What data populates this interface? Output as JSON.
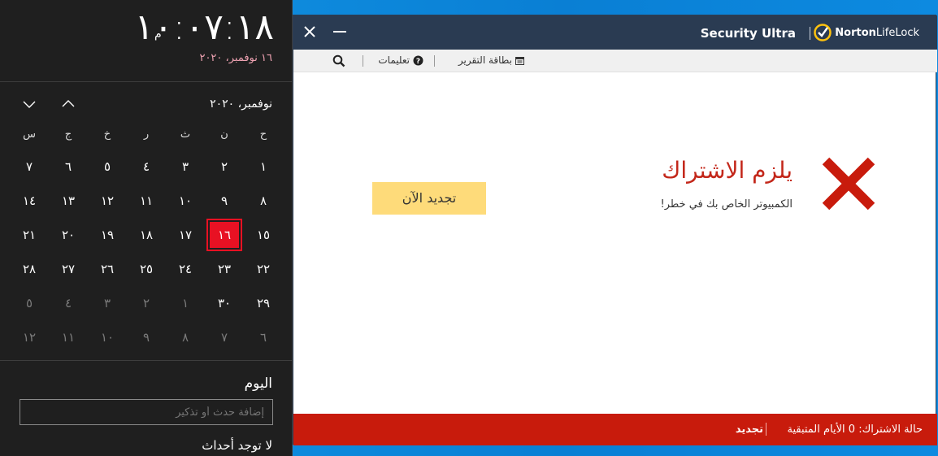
{
  "flyout": {
    "clock": "١٠:٠٧:١٨",
    "ampm": "م",
    "date_line": "١٦ نوفمبر، ٢٠٢٠",
    "month_title": "نوفمبر، ٢٠٢٠",
    "weekdays": [
      "ح",
      "ن",
      "ث",
      "ر",
      "خ",
      "ج",
      "س"
    ],
    "weeks": [
      [
        {
          "d": "١"
        },
        {
          "d": "٢"
        },
        {
          "d": "٣"
        },
        {
          "d": "٤"
        },
        {
          "d": "٥"
        },
        {
          "d": "٦"
        },
        {
          "d": "٧"
        }
      ],
      [
        {
          "d": "٨"
        },
        {
          "d": "٩"
        },
        {
          "d": "١٠"
        },
        {
          "d": "١١"
        },
        {
          "d": "١٢"
        },
        {
          "d": "١٣"
        },
        {
          "d": "١٤"
        }
      ],
      [
        {
          "d": "١٥"
        },
        {
          "d": "١٦",
          "today": true
        },
        {
          "d": "١٧"
        },
        {
          "d": "١٨"
        },
        {
          "d": "١٩"
        },
        {
          "d": "٢٠"
        },
        {
          "d": "٢١"
        }
      ],
      [
        {
          "d": "٢٢"
        },
        {
          "d": "٢٣"
        },
        {
          "d": "٢٤"
        },
        {
          "d": "٢٥"
        },
        {
          "d": "٢٦"
        },
        {
          "d": "٢٧"
        },
        {
          "d": "٢٨"
        }
      ],
      [
        {
          "d": "٢٩"
        },
        {
          "d": "٣٠"
        },
        {
          "d": "١",
          "dim": true
        },
        {
          "d": "٢",
          "dim": true
        },
        {
          "d": "٣",
          "dim": true
        },
        {
          "d": "٤",
          "dim": true
        },
        {
          "d": "٥",
          "dim": true
        }
      ],
      [
        {
          "d": "٦",
          "dim": true
        },
        {
          "d": "٧",
          "dim": true
        },
        {
          "d": "٨",
          "dim": true
        },
        {
          "d": "٩",
          "dim": true
        },
        {
          "d": "١٠",
          "dim": true
        },
        {
          "d": "١١",
          "dim": true
        },
        {
          "d": "١٢",
          "dim": true
        }
      ]
    ],
    "today_label": "اليوم",
    "event_placeholder": "إضافة حدث أو تذكير",
    "no_events": "لا توجد أحداث",
    "icons": {
      "prev": "chevron-up-icon",
      "next": "chevron-down-icon"
    },
    "colors": {
      "today_accent": "#e81123",
      "date_line": "#f0a3b3"
    }
  },
  "norton": {
    "product_name": "Security Ultra",
    "brand_name_bold": "Norton",
    "brand_name_light": "LifeLock",
    "menu": {
      "report_card": "بطاقة التقرير",
      "help": "تعليمات"
    },
    "alert": {
      "title": "يلزم الاشتراك",
      "subtitle": "الكمبيوتر الخاص بك في خطر!",
      "renew_button": "تجديد الآن"
    },
    "status": {
      "text": "حالة الاشتراك:  0 الأيام المتبقية",
      "renew_link": "تجديد"
    },
    "colors": {
      "titlebar": "#2a3b52",
      "alert_red": "#c3271a",
      "status_bar": "#c81b0c",
      "renew_button": "#fedb7a",
      "logo_yellow": "#ffc20e"
    }
  }
}
